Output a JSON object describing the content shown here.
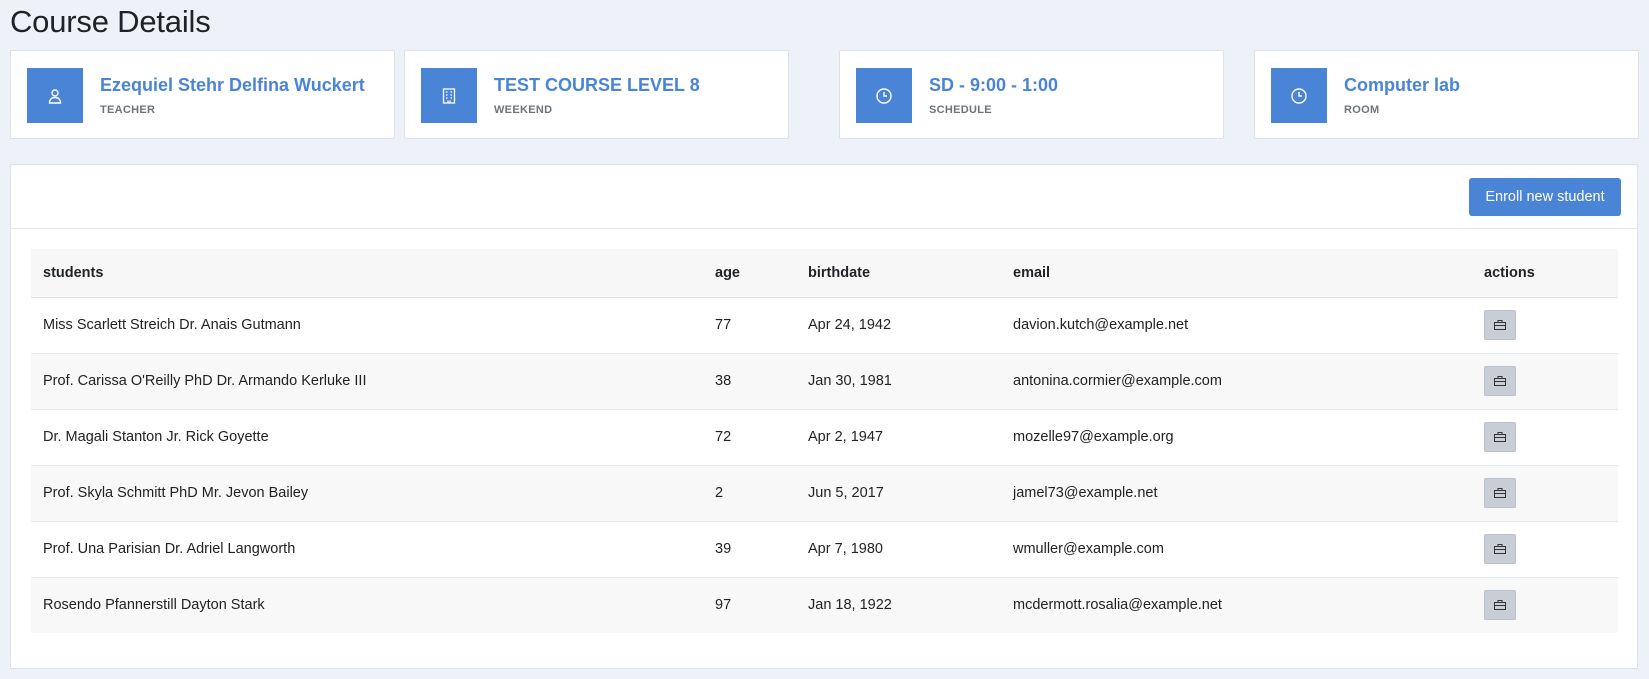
{
  "page_title": "Course Details",
  "cards": [
    {
      "icon": "user-icon",
      "title": "Ezequiel Stehr Delfina Wuckert",
      "subtitle": "TEACHER"
    },
    {
      "icon": "building-icon",
      "title": "TEST COURSE LEVEL 8",
      "subtitle": "WEEKEND"
    },
    {
      "icon": "clock-icon",
      "title": "SD - 9:00 - 1:00",
      "subtitle": "SCHEDULE"
    },
    {
      "icon": "clock-icon",
      "title": "Computer lab",
      "subtitle": "ROOM"
    }
  ],
  "toolbar": {
    "enroll_label": "Enroll new student"
  },
  "table": {
    "headers": [
      "students",
      "age",
      "birthdate",
      "email",
      "actions"
    ],
    "rows": [
      {
        "student": "Miss Scarlett Streich Dr. Anais Gutmann",
        "age": "77",
        "birthdate": "Apr 24, 1942",
        "email": "davion.kutch@example.net"
      },
      {
        "student": "Prof. Carissa O'Reilly PhD Dr. Armando Kerluke III",
        "age": "38",
        "birthdate": "Jan 30, 1981",
        "email": "antonina.cormier@example.com"
      },
      {
        "student": "Dr. Magali Stanton Jr. Rick Goyette",
        "age": "72",
        "birthdate": "Apr 2, 1947",
        "email": "mozelle97@example.org"
      },
      {
        "student": "Prof. Skyla Schmitt PhD Mr. Jevon Bailey",
        "age": "2",
        "birthdate": "Jun 5, 2017",
        "email": "jamel73@example.net"
      },
      {
        "student": "Prof. Una Parisian Dr. Adriel Langworth",
        "age": "39",
        "birthdate": "Apr 7, 1980",
        "email": "wmuller@example.com"
      },
      {
        "student": "Rosendo Pfannerstill Dayton Stark",
        "age": "97",
        "birthdate": "Jan 18, 1922",
        "email": "mcdermott.rosalia@example.net"
      }
    ],
    "row_action_icon": "briefcase-icon"
  },
  "colors": {
    "accent": "#4a84d6",
    "background": "#eef1f8",
    "action_button": "#c9ced6"
  }
}
